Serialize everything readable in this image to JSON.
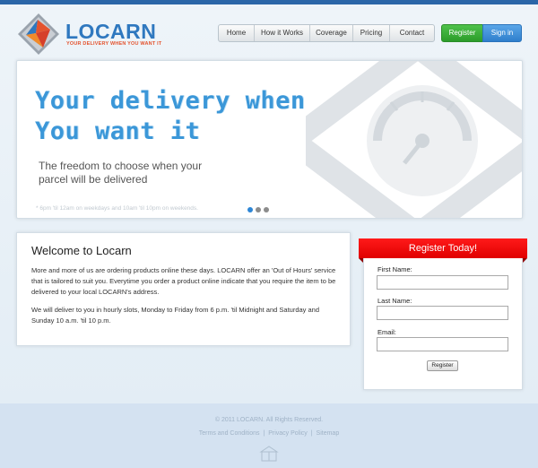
{
  "brand": {
    "name": "LOCARN",
    "tagline": "YOUR DELIVERY WHEN YOU WANT IT",
    "colors": {
      "primary": "#2f78bf",
      "accent": "#e4532e"
    }
  },
  "nav": {
    "items": [
      {
        "label": "Home"
      },
      {
        "label": "How it Works"
      },
      {
        "label": "Coverage"
      },
      {
        "label": "Pricing"
      },
      {
        "label": "Contact"
      }
    ],
    "register_label": "Register",
    "signin_label": "Sign in"
  },
  "hero": {
    "headline": "Your delivery when\nYou want it",
    "subtext": "The freedom to choose when your parcel will be delivered",
    "note": "* 6pm 'til 12am on weekdays and 10am 'til 10pm on weekends.",
    "slides": {
      "count": 3,
      "active": 0
    },
    "art_icon": "clock-icon"
  },
  "welcome": {
    "title": "Welcome to Locarn",
    "paragraph1": "More and more of us are ordering products online these days. LOCARN offer an 'Out of Hours' service that is tailored to suit you. Everytime you order a product online indicate that you require the item to be delivered to your local LOCARN's address.",
    "paragraph2": "We will deliver to you in hourly slots, Monday to Friday from 6 p.m. 'til Midnight and Saturday and Sunday 10 a.m. 'til 10 p.m."
  },
  "register_form": {
    "title": "Register Today!",
    "first_name_label": "First Name:",
    "first_name_value": "",
    "last_name_label": "Last Name:",
    "last_name_value": "",
    "email_label": "Email:",
    "email_value": "",
    "submit_label": "Register",
    "ribbon_color": "#ff0000"
  },
  "footer": {
    "copyright": "© 2011 LOCARN. All Rights Reserved.",
    "links": [
      {
        "label": "Terms and Conditions"
      },
      {
        "label": "Privacy Policy"
      },
      {
        "label": "Sitemap"
      }
    ],
    "separator": "|"
  }
}
